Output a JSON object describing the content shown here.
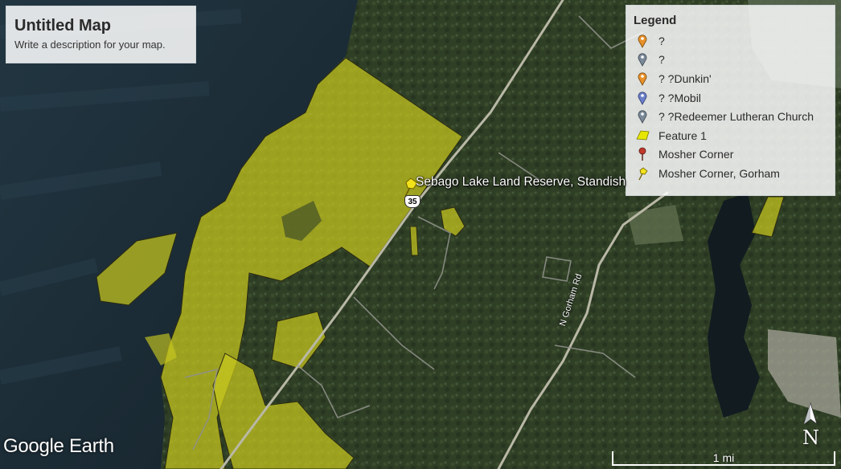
{
  "title_panel": {
    "title": "Untitled Map",
    "description": "Write a description for your map."
  },
  "legend": {
    "title": "Legend",
    "items": [
      {
        "label": "?",
        "icon": "orange-pin-icon",
        "color": "#e8912a"
      },
      {
        "label": "?",
        "icon": "gray-pin-icon",
        "color": "#7b8a99"
      },
      {
        "label": "? ?Dunkin'",
        "icon": "orange-pin-icon",
        "color": "#e8912a"
      },
      {
        "label": "? ?Mobil",
        "icon": "blue-pin-icon",
        "color": "#6b7fc9"
      },
      {
        "label": "? ?Redeemer Lutheran Church",
        "icon": "gray-pin-icon",
        "color": "#7b8a99"
      },
      {
        "label": "Feature 1",
        "icon": "polygon-icon",
        "color": "#e6e600"
      },
      {
        "label": "Mosher Corner",
        "icon": "red-pin-icon",
        "color": "#c0392b"
      },
      {
        "label": "Mosher Corner, Gorham",
        "icon": "yellow-pushpin-icon",
        "color": "#f2e21a"
      }
    ]
  },
  "map": {
    "place_label": "Sebago Lake Land Reserve, Standish",
    "route_shield": "35",
    "road_label": "N Gorham Rd",
    "feature_fill_color": "#c8c81e",
    "water_color": "#1a2b35"
  },
  "logo": "Google Earth",
  "north_arrow": "N",
  "scale_label": "1 mi"
}
